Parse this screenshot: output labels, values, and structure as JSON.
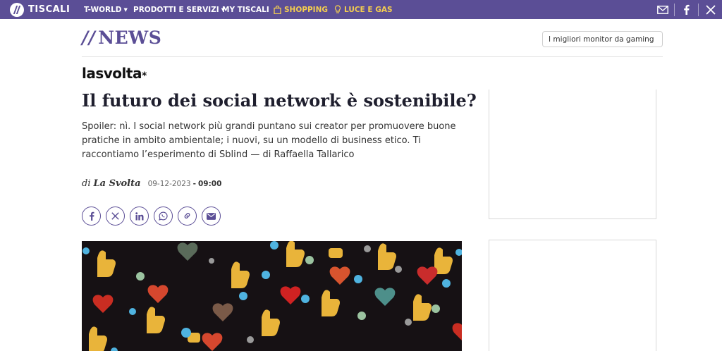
{
  "topbar": {
    "logo_text": "TISCALI",
    "nav": [
      {
        "label": "T-WORLD",
        "caret": "▼"
      },
      {
        "label": "PRODOTTI E SERVIZI",
        "caret": "▼"
      },
      {
        "label": "MY TISCALI"
      },
      {
        "label": "SHOPPING",
        "icon": "shopping-bag-icon"
      },
      {
        "label": "LUCE E GAS",
        "icon": "lightbulb-icon"
      }
    ],
    "right_icons": [
      "mail-icon",
      "facebook-icon",
      "x-icon"
    ]
  },
  "section": {
    "slashes": "//",
    "title": "NEWS",
    "promo_pill": "I migliori monitor da gaming"
  },
  "brand": {
    "name": "lasvolta",
    "mark": "*"
  },
  "article": {
    "headline": "Il futuro dei social network è sostenibile?",
    "summary": "Spoiler: nì. I social network più grandi puntano sui creator per promuovere buone pratiche in ambito ambientale; i nuovi, su un modello di business etico. Ti raccontiamo l’esperimento di Sblind — di Raffaella Tallarico",
    "byline_prefix": "di",
    "author": "La Svolta",
    "date": "09-12-2023",
    "time_sep": "-",
    "time": "09:00"
  },
  "share_buttons": [
    "facebook-icon",
    "x-icon",
    "linkedin-icon",
    "whatsapp-icon",
    "link-icon",
    "email-icon"
  ],
  "colors": {
    "brand_purple": "#5b4e96",
    "nav_gold": "#f4cd4f"
  }
}
